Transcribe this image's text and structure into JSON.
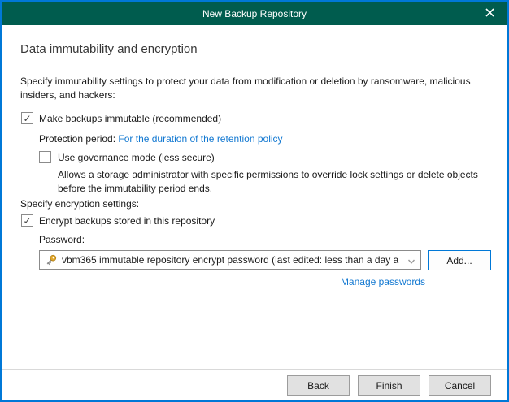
{
  "window": {
    "title": "New Backup Repository"
  },
  "page": {
    "heading": "Data immutability and encryption",
    "immutability_intro": "Specify immutability settings to protect your data from modification or deletion by ransomware, malicious insiders, and hackers:",
    "make_immutable": {
      "label": "Make backups immutable (recommended)",
      "checked": true
    },
    "protection_period": {
      "label": "Protection period:",
      "link": "For the duration of the retention policy"
    },
    "governance": {
      "label": "Use governance mode (less secure)",
      "checked": false,
      "description": "Allows a storage administrator with specific permissions to override lock settings or delete objects before the immutability period ends."
    },
    "encryption_intro": "Specify encryption settings:",
    "encrypt": {
      "label": "Encrypt backups stored in this repository",
      "checked": true
    },
    "password": {
      "label": "Password:",
      "selected_value": "vbm365 immutable repository encrypt password (last edited: less than a day a",
      "add_button": "Add...",
      "manage_link": "Manage passwords"
    }
  },
  "footer": {
    "back": "Back",
    "finish": "Finish",
    "cancel": "Cancel"
  },
  "icons": {
    "check_glyph": "✓",
    "close": "close-icon",
    "chevron": "chevron-down-icon",
    "key": "key-icon"
  },
  "colors": {
    "titlebar_green": "#005C4E",
    "window_border_blue": "#0078D7",
    "link_blue": "#1278D1",
    "add_button_border": "#0078D7"
  }
}
